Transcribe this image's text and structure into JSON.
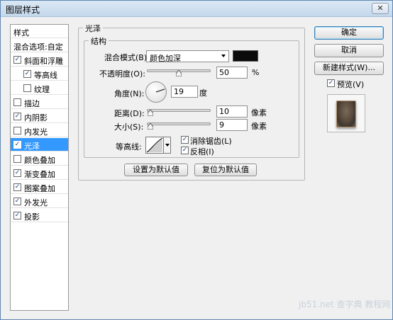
{
  "window": {
    "title": "图层样式",
    "close_icon": "close-icon"
  },
  "style_list": {
    "header_styles": "样式",
    "header_blend": "混合选项:自定",
    "items": [
      {
        "label": "斜面和浮雕",
        "checked": true
      },
      {
        "label": "等高线",
        "checked": true
      },
      {
        "label": "纹理",
        "checked": false
      },
      {
        "label": "描边",
        "checked": false
      },
      {
        "label": "内阴影",
        "checked": true
      },
      {
        "label": "内发光",
        "checked": false
      },
      {
        "label": "光泽",
        "checked": true,
        "selected": true
      },
      {
        "label": "颜色叠加",
        "checked": false
      },
      {
        "label": "渐变叠加",
        "checked": true
      },
      {
        "label": "图案叠加",
        "checked": true
      },
      {
        "label": "外发光",
        "checked": true
      },
      {
        "label": "投影",
        "checked": true
      }
    ]
  },
  "panel": {
    "section_title": "光泽",
    "structure_title": "结构",
    "blend_mode_label": "混合模式(B):",
    "blend_mode_value": "颜色加深",
    "blend_color": "#0a0a0a",
    "opacity_label": "不透明度(O):",
    "opacity_value": "50",
    "opacity_unit": "%",
    "opacity_level": 0.5,
    "angle_label": "角度(N):",
    "angle_value": "19",
    "angle_unit": "度",
    "distance_label": "距离(D):",
    "distance_value": "10",
    "distance_unit": "像素",
    "distance_level": 0.05,
    "size_label": "大小(S):",
    "size_value": "9",
    "size_unit": "像素",
    "size_level": 0.05,
    "contour_label": "等高线:",
    "antialias_label": "消除锯齿(L)",
    "antialias_checked": true,
    "invert_label": "反相(I)",
    "invert_checked": true,
    "set_default_label": "设置为默认值",
    "reset_default_label": "复位为默认值"
  },
  "actions": {
    "ok_label": "确定",
    "cancel_label": "取消",
    "new_style_label": "新建样式(W)...",
    "preview_label": "预览(V)",
    "preview_checked": true
  },
  "watermark": "jb51.net 查字典 教程网"
}
